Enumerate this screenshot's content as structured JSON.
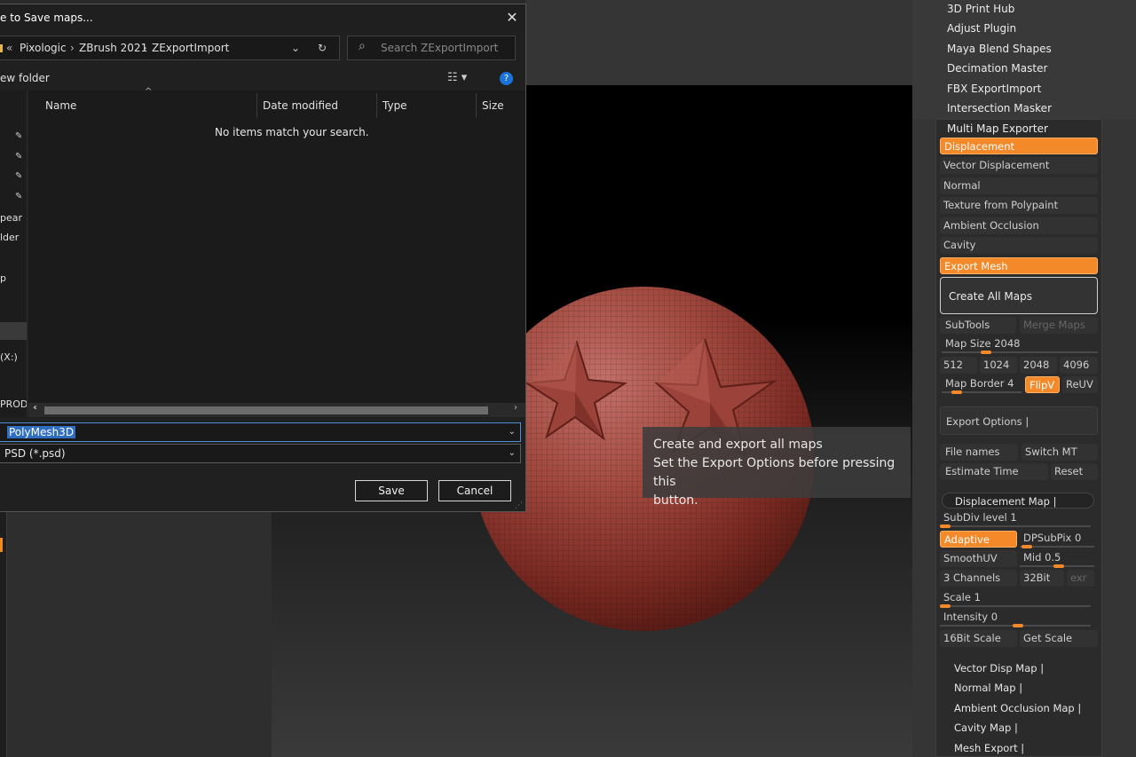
{
  "dialog": {
    "title": "e to Save maps...",
    "close": "✕",
    "breadcrumb": [
      "Pixologic",
      "ZBrush 2021",
      "ZExportImport"
    ],
    "search_placeholder": "Search ZExportImport",
    "new_folder": "ew folder",
    "columns": [
      "Name",
      "Date modified",
      "Type",
      "Size"
    ],
    "empty_message": "No items match your search.",
    "nav_items": [
      "",
      "",
      "",
      "",
      "pear",
      "lder",
      "",
      "p",
      "",
      "",
      "(X:)",
      "",
      "PRODU"
    ],
    "filename": "PolyMesh3D",
    "filetype": "PSD (*.psd)",
    "save_label": "Save",
    "cancel_label": "Cancel"
  },
  "tooltip": {
    "line1": "Create and export all maps",
    "line2": "Set the Export Options before pressing this",
    "line3": "button."
  },
  "plugins": [
    "3D Print Hub",
    "Adjust Plugin",
    "Maya Blend Shapes",
    "Decimation Master",
    "FBX ExportImport",
    "Intersection Masker"
  ],
  "mme": {
    "header": "Multi Map Exporter",
    "map_buttons": [
      {
        "label": "Displacement",
        "on": true
      },
      {
        "label": "Vector Displacement",
        "on": false
      },
      {
        "label": "Normal",
        "on": false
      },
      {
        "label": "Texture from Polypaint",
        "on": false
      },
      {
        "label": "Ambient Occlusion",
        "on": false
      },
      {
        "label": "Cavity",
        "on": false
      },
      {
        "label": "Export Mesh",
        "on": true
      }
    ],
    "create_all": "Create All Maps",
    "subtools": "SubTools",
    "merge_maps": "Merge Maps",
    "map_size_label": "Map Size",
    "map_size_value": "2048",
    "map_size_fraction": 0.25,
    "sizes": [
      "512",
      "1024",
      "2048",
      "4096"
    ],
    "map_border_label": "Map Border",
    "map_border_value": "4",
    "map_border_fraction": 0.12,
    "flipv": "FlipV",
    "reuv": "ReUV",
    "export_options": "Export Options",
    "file_names": "File names",
    "switch_mt": "Switch MT",
    "estimate_time": "Estimate Time",
    "reset": "Reset",
    "disp_map": "Displacement Map",
    "subdiv_label": "SubDiv level",
    "subdiv_value": "1",
    "adaptive": "Adaptive",
    "dpsubpix_label": "DPSubPix",
    "dpsubpix_value": "0",
    "smoothuv": "SmoothUV",
    "mid_label": "Mid",
    "mid_value": "0.5",
    "three_channels": "3 Channels",
    "bit32": "32Bit",
    "exr": "exr",
    "scale_label": "Scale",
    "scale_value": "1",
    "intensity_label": "Intensity",
    "intensity_value": "0",
    "bit16_scale": "16Bit Scale",
    "get_scale": "Get Scale",
    "sub_sections": [
      "Vector Disp Map",
      "Normal Map",
      "Ambient Occlusion Map",
      "Cavity Map",
      "Mesh Export"
    ]
  },
  "colors": {
    "accent": "#f4892a",
    "sphere": "#a24a40",
    "dialog_bg": "#202020"
  }
}
